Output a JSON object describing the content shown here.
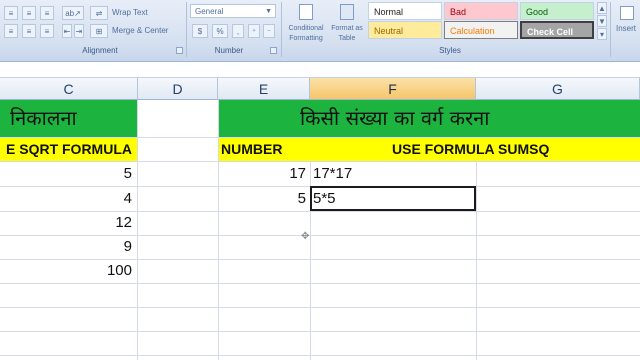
{
  "ribbon": {
    "alignment": {
      "wrap_text": "Wrap Text",
      "merge_center": "Merge & Center",
      "group_label": "Alignment"
    },
    "number": {
      "format_value": "General",
      "currency_symbol": "$",
      "percent_symbol": "%",
      "comma_symbol": ",",
      "group_label": "Number"
    },
    "styles": {
      "conditional_formatting": "Conditional Formatting",
      "format_as_table": "Format as Table",
      "normal": "Normal",
      "bad": "Bad",
      "good": "Good",
      "neutral": "Neutral",
      "calculation": "Calculation",
      "check_cell": "Check Cell",
      "group_label": "Styles"
    },
    "cells": {
      "insert": "Insert"
    }
  },
  "columns": [
    "C",
    "D",
    "E",
    "F",
    "G"
  ],
  "sheet": {
    "c_header_hindi": "निकालना",
    "ef_header_hindi": "किसी संख्या का वर्ग करना",
    "c_subheader": "E SQRT FORMULA",
    "e_subheader": "NUMBER",
    "fg_subheader": "USE FORMULA SUMSQ",
    "c_values": [
      "5",
      "4",
      "12",
      "9",
      "100"
    ],
    "e_values": [
      "17",
      "5"
    ],
    "f_values": [
      "17*17",
      "5*5"
    ]
  },
  "colors": {
    "green_band": "#1db33f",
    "yellow_band": "#ffff00",
    "active_column": "#f5c66a"
  }
}
